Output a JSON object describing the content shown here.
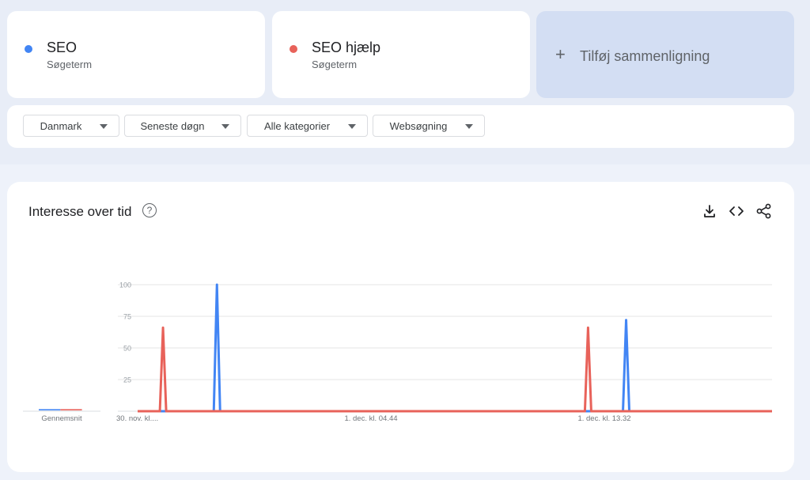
{
  "terms": [
    {
      "name": "SEO",
      "sub": "Søgeterm",
      "color": "#4285f4"
    },
    {
      "name": "SEO hjælp",
      "sub": "Søgeterm",
      "color": "#e8625a"
    }
  ],
  "add_compare": {
    "plus": "+",
    "label": "Tilføj sammenligning"
  },
  "filters": [
    "Danmark",
    "Seneste døgn",
    "Alle kategorier",
    "Websøgning"
  ],
  "chart_card": {
    "title": "Interesse over tid",
    "help": "?"
  },
  "chart_data": {
    "type": "line",
    "title": "Interesse over tid",
    "ylim": [
      0,
      100
    ],
    "yticks": [
      25,
      50,
      75,
      100
    ],
    "x_tick_labels": [
      "30. nov. kl....",
      "1. dec. kl. 04.44",
      "1. dec. kl. 13.32"
    ],
    "average_label": "Gennemsnit",
    "average": {
      "SEO": 1,
      "SEO hjælp": 1
    },
    "grid": true,
    "series": [
      {
        "name": "SEO",
        "color": "#4285f4",
        "peaks": [
          {
            "at": 0.125,
            "value": 100
          },
          {
            "at": 0.77,
            "value": 72
          }
        ]
      },
      {
        "name": "SEO hjælp",
        "color": "#e8625a",
        "peaks": [
          {
            "at": 0.04,
            "value": 66
          },
          {
            "at": 0.71,
            "value": 66
          }
        ]
      }
    ]
  }
}
